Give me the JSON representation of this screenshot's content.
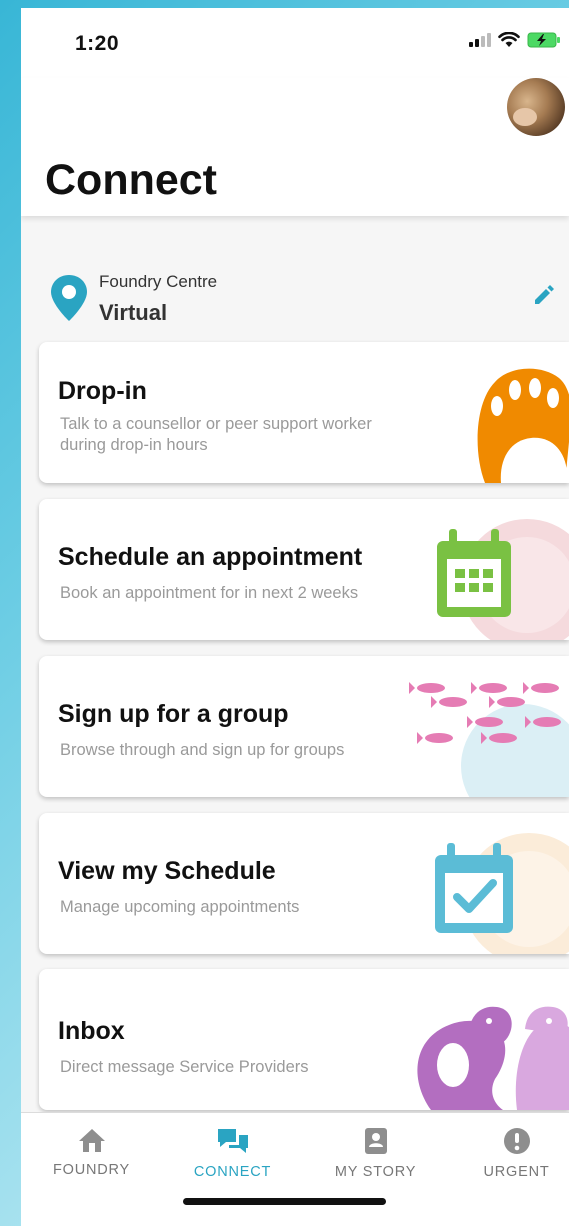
{
  "status_bar": {
    "time": "1:20"
  },
  "header": {
    "title": "Connect"
  },
  "location": {
    "label": "Foundry Centre",
    "value": "Virtual"
  },
  "cards": [
    {
      "title": "Drop-in",
      "subtitle": "Talk to a counsellor or peer support worker during drop-in hours"
    },
    {
      "title": "Schedule an appointment",
      "subtitle": "Book an appointment for in next 2 weeks"
    },
    {
      "title": "Sign up for a group",
      "subtitle": "Browse through and sign up for groups"
    },
    {
      "title": "View my Schedule",
      "subtitle": "Manage upcoming appointments"
    },
    {
      "title": "Inbox",
      "subtitle": "Direct message Service Providers"
    }
  ],
  "nav": [
    {
      "label": "FOUNDRY",
      "icon": "home-icon"
    },
    {
      "label": "CONNECT",
      "icon": "chat-icon",
      "active": true
    },
    {
      "label": "MY STORY",
      "icon": "book-icon"
    },
    {
      "label": "URGENT",
      "icon": "alert-icon"
    }
  ],
  "colors": {
    "accent": "#2aa4c2",
    "drop_in_art": "#f08a00",
    "schedule_art": "#7ac143",
    "group_art": "#e57cb4",
    "my_schedule_art": "#5bbcd6",
    "inbox_art": "#b36ec0"
  }
}
